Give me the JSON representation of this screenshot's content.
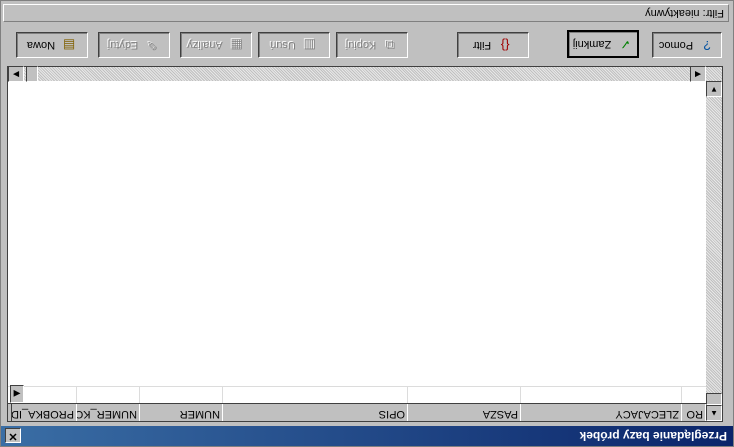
{
  "window": {
    "title": "Przeglądanie bazy próbek",
    "close_glyph": "✕"
  },
  "grid": {
    "columns": [
      "PROBKA_ID",
      "NUMER_KOL",
      "NUMER",
      "OPIS",
      "PASZA",
      "ZLECAJACY",
      "RO"
    ]
  },
  "toolbar": {
    "nowa": "Nowa",
    "edytuj": "Edytuj",
    "analizy": "Analizy",
    "usun": "Usuń",
    "kopiuj": "Kopiuj",
    "filtr": "Filtr",
    "zamknij": "Zamknij",
    "pomoc": "Pomoc"
  },
  "status": {
    "filter": "Filtr: nieaktywny"
  },
  "icons": {
    "row_selector": "triangle-right-icon",
    "close": "close-icon"
  }
}
